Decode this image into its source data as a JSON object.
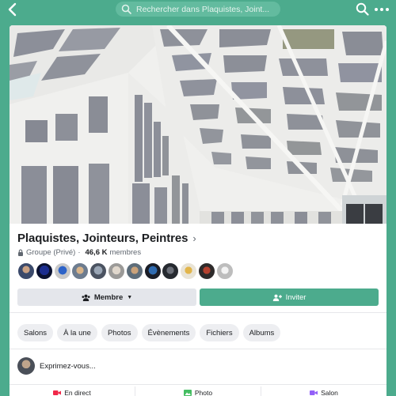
{
  "topbar": {
    "search_placeholder": "Rechercher dans Plaquistes, Joint...",
    "icons": [
      "back-arrow-icon",
      "search-icon",
      "more-icon"
    ]
  },
  "group": {
    "name": "Plaquistes, Jointeurs, Peintres",
    "privacy": "Groupe (Privé)",
    "separator": "·",
    "members_count": "46,6 K",
    "members_label": "membres"
  },
  "buttons": {
    "member_label": "Membre",
    "invite_label": "Inviter"
  },
  "tabs": [
    "Salons",
    "À la une",
    "Photos",
    "Évènements",
    "Fichiers",
    "Albums"
  ],
  "composer": {
    "prompt": "Exprimez-vous..."
  },
  "actions": [
    {
      "label": "En direct",
      "icon": "live-video-icon",
      "color": "#f02849"
    },
    {
      "label": "Photo",
      "icon": "photo-icon",
      "color": "#45bd62"
    },
    {
      "label": "Salon",
      "icon": "room-icon",
      "color": "#9360f7"
    }
  ],
  "colors": {
    "accent": "#4cab8d",
    "text": "#1c1e21",
    "secondary_text": "#606770"
  }
}
